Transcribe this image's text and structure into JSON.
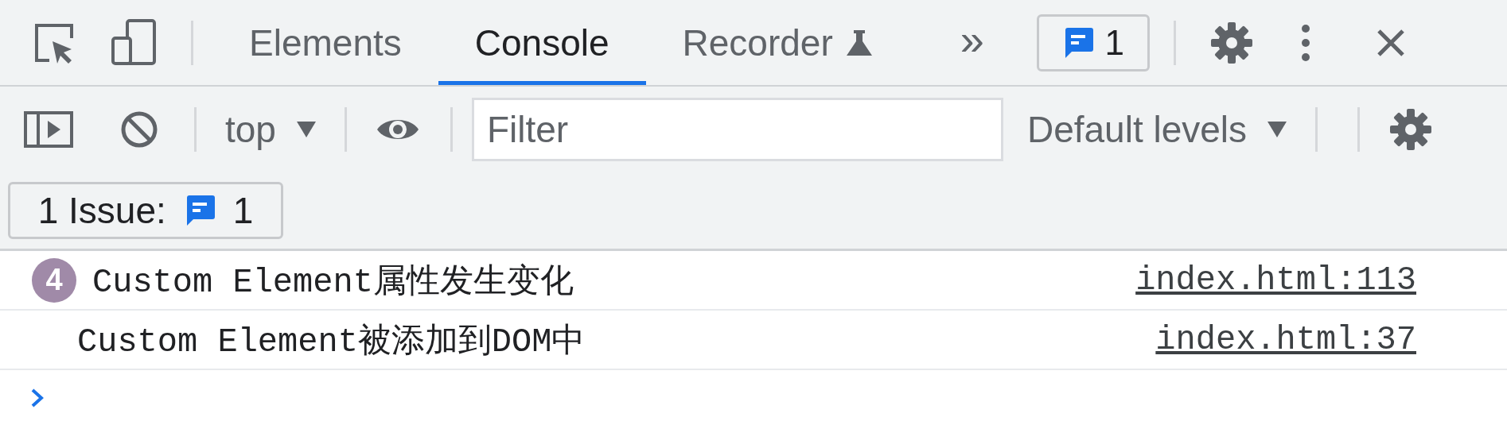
{
  "tabs": [
    {
      "label": "Elements",
      "selected": false,
      "kind": "plain"
    },
    {
      "label": "Console",
      "selected": true,
      "kind": "plain"
    },
    {
      "label": "Recorder",
      "selected": false,
      "kind": "experimental"
    }
  ],
  "more_tabs": "»",
  "issues_badge": {
    "count": "1"
  },
  "toolbar": {
    "context": "top",
    "filter": {
      "placeholder": "Filter"
    },
    "levels": "Default levels"
  },
  "issues_button": {
    "label": "1 Issue:",
    "count": "1"
  },
  "messages": [
    {
      "count": "4",
      "text": "Custom Element属性发生变化",
      "source": "index.html:113"
    },
    {
      "text": "Custom Element被添加到DOM中",
      "source": "index.html:37"
    }
  ]
}
